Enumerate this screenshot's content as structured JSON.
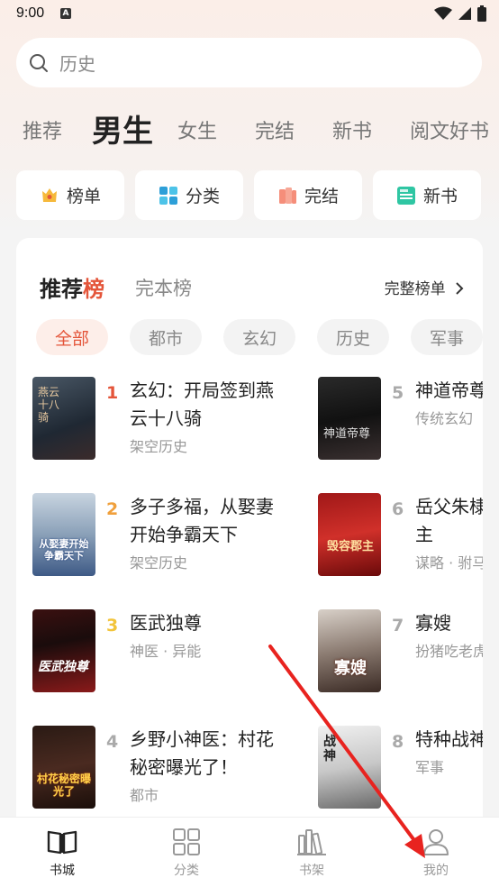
{
  "status": {
    "time": "9:00",
    "a_badge": "A"
  },
  "search": {
    "placeholder": "历史"
  },
  "category_tabs": [
    "推荐",
    "男生",
    "女生",
    "完结",
    "新书",
    "阅文好书"
  ],
  "quick_nav": [
    {
      "label": "榜单",
      "icon": "crown-icon"
    },
    {
      "label": "分类",
      "icon": "grid-icon"
    },
    {
      "label": "完结",
      "icon": "books-icon"
    },
    {
      "label": "新书",
      "icon": "new-badge-icon"
    }
  ],
  "rank": {
    "title_prefix": "推荐",
    "title_hi": "榜",
    "sub": "完本榜",
    "more": "完整榜单",
    "chips": [
      "全部",
      "都市",
      "玄幻",
      "历史",
      "军事"
    ],
    "books": [
      {
        "num": "1",
        "title": "玄幻：开局签到燕云十八骑",
        "tag": "架空历史",
        "cover_text": "燕云十八骑"
      },
      {
        "num": "2",
        "title": "多子多福，从娶妻开始争霸天下",
        "tag": "架空历史",
        "cover_text": "从娶妻开始争霸天下"
      },
      {
        "num": "3",
        "title": "医武独尊",
        "tag": "神医 · 异能",
        "cover_text": "医武独尊"
      },
      {
        "num": "4",
        "title": "乡野小神医：村花秘密曝光了！",
        "tag": "都市",
        "cover_text": "村花秘密曝光了"
      },
      {
        "num": "5",
        "title": "神道帝尊",
        "tag": "传统玄幻",
        "cover_text": "神道帝尊"
      },
      {
        "num": "6",
        "title": "岳父朱棣，毁容郡主",
        "tag": "谋略 · 驸马",
        "cover_text": "毁容郡主"
      },
      {
        "num": "7",
        "title": "寡嫂",
        "tag": "扮猪吃老虎",
        "cover_text": "寡嫂"
      },
      {
        "num": "8",
        "title": "特种战神",
        "tag": "军事",
        "cover_text": "战神"
      }
    ]
  },
  "bottom_nav": [
    {
      "label": "书城",
      "icon": "book-open-icon"
    },
    {
      "label": "分类",
      "icon": "grid-icon"
    },
    {
      "label": "书架",
      "icon": "bookshelf-icon"
    },
    {
      "label": "我的",
      "icon": "user-icon"
    }
  ],
  "colors": {
    "accent": "#e4553a",
    "rank_gold": "#f2b43a",
    "rank_gray": "#aaaaaa"
  }
}
